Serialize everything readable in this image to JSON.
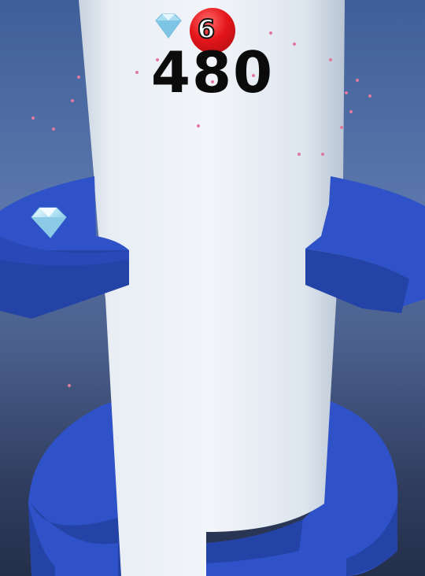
{
  "hud": {
    "gem_count": "6",
    "score": "480"
  },
  "colors": {
    "background_top": "#3f5f9a",
    "background_bottom": "#242f4a",
    "tower": "#dfe6ee",
    "platform": "#2f52c8",
    "platform_side": "#2443a6",
    "gem_badge": "#e4161b",
    "gem": "#a8ddf2"
  },
  "icons": {
    "gem_counter": "diamond-icon",
    "collectible": "diamond-icon"
  }
}
